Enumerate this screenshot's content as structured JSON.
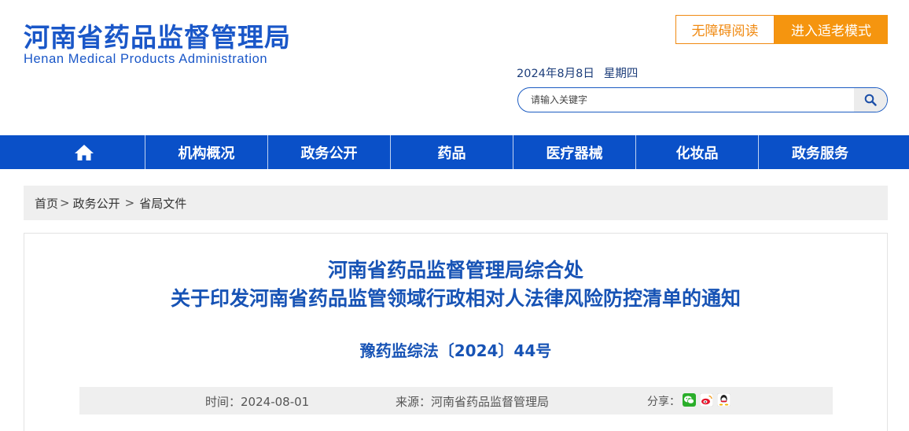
{
  "header": {
    "logo_cn": "河南省药品监督管理局",
    "logo_en": "Henan Medical Products Administration",
    "accessible_label": "无障碍阅读",
    "elder_mode_label": "进入适老模式",
    "date": "2024年8月8日",
    "weekday": "星期四",
    "search_placeholder": "请输入关键字",
    "search_icon": "search-icon"
  },
  "nav": {
    "home_icon": "home-icon",
    "items": [
      "机构概况",
      "政务公开",
      "药品",
      "医疗器械",
      "化妆品",
      "政务服务"
    ]
  },
  "breadcrumb": {
    "items": [
      "首页",
      "政务公开",
      "省局文件"
    ],
    "separator": ">"
  },
  "article": {
    "title_line1": "河南省药品监督管理局综合处",
    "title_line2": "关于印发河南省药品监管领域行政相对人法律风险防控清单的通知",
    "doc_number": "豫药监综法〔2024〕44号",
    "time_label": "时间：",
    "time_value": "2024-08-01",
    "source_label": "来源：",
    "source_value": "河南省药品监督管理局",
    "share_label": "分享：",
    "share_icons": [
      "wechat-icon",
      "weibo-icon",
      "qq-icon"
    ]
  },
  "colors": {
    "brand_blue": "#1a57c8",
    "nav_blue": "#0a50c8",
    "accent_orange": "#f5950f"
  }
}
